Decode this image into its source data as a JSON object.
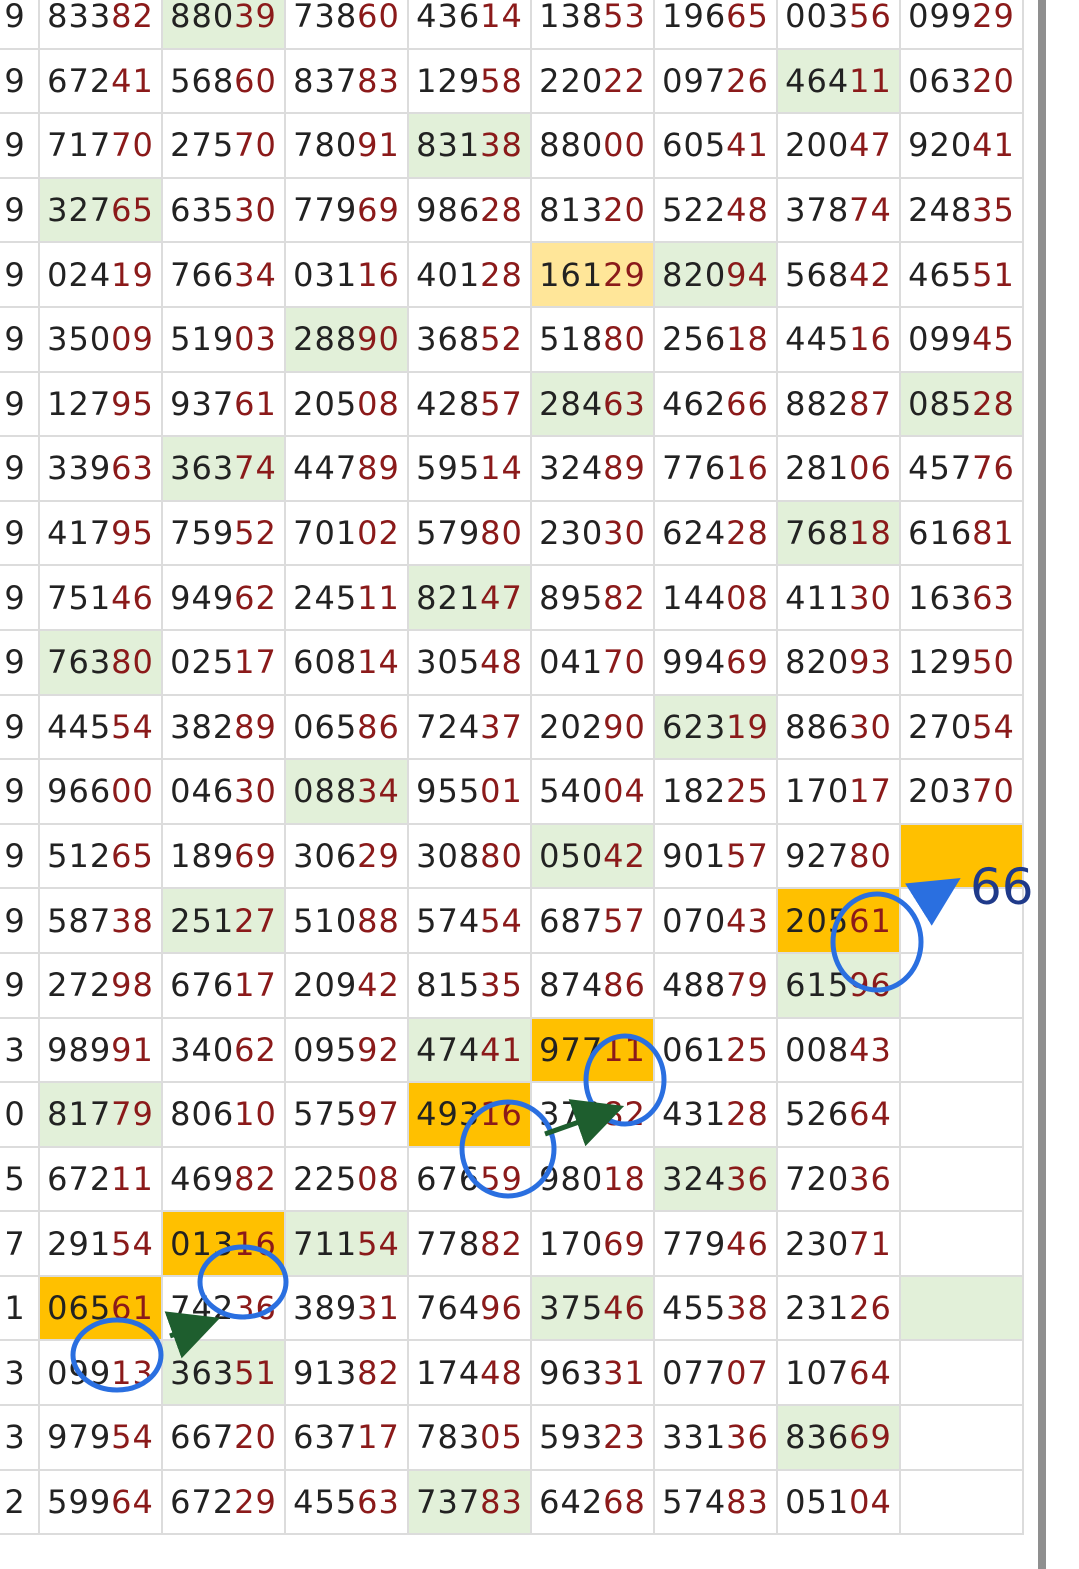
{
  "annotation_text": "66",
  "colors": {
    "cell_green": "#e2f0d9",
    "cell_yellow": "#ffc000",
    "cell_light_yellow": "#ffe699",
    "digit_dark": "#222222",
    "digit_red": "#8b1a1a",
    "circle_blue": "#2a6fe0",
    "arrow_green": "#1e5e2e"
  },
  "rows": [
    {
      "idx": "9",
      "cells": [
        {
          "v": "83382",
          "c": ""
        },
        {
          "v": "88039",
          "c": "g"
        },
        {
          "v": "73860",
          "c": ""
        },
        {
          "v": "43614",
          "c": ""
        },
        {
          "v": "13853",
          "c": ""
        },
        {
          "v": "19665",
          "c": ""
        },
        {
          "v": "00356",
          "c": ""
        },
        {
          "v": "09929",
          "c": ""
        }
      ]
    },
    {
      "idx": "9",
      "cells": [
        {
          "v": "67241",
          "c": ""
        },
        {
          "v": "56860",
          "c": ""
        },
        {
          "v": "83783",
          "c": ""
        },
        {
          "v": "12958",
          "c": ""
        },
        {
          "v": "22022",
          "c": ""
        },
        {
          "v": "09726",
          "c": ""
        },
        {
          "v": "46411",
          "c": "g"
        },
        {
          "v": "06320",
          "c": ""
        }
      ]
    },
    {
      "idx": "9",
      "cells": [
        {
          "v": "71770",
          "c": ""
        },
        {
          "v": "27570",
          "c": ""
        },
        {
          "v": "78091",
          "c": ""
        },
        {
          "v": "83138",
          "c": "g"
        },
        {
          "v": "88000",
          "c": ""
        },
        {
          "v": "60541",
          "c": ""
        },
        {
          "v": "20047",
          "c": ""
        },
        {
          "v": "92041",
          "c": ""
        }
      ]
    },
    {
      "idx": "9",
      "cells": [
        {
          "v": "32765",
          "c": "g"
        },
        {
          "v": "63530",
          "c": ""
        },
        {
          "v": "77969",
          "c": ""
        },
        {
          "v": "98628",
          "c": ""
        },
        {
          "v": "81320",
          "c": ""
        },
        {
          "v": "52248",
          "c": ""
        },
        {
          "v": "37874",
          "c": ""
        },
        {
          "v": "24835",
          "c": ""
        }
      ]
    },
    {
      "idx": "9",
      "cells": [
        {
          "v": "02419",
          "c": ""
        },
        {
          "v": "76634",
          "c": ""
        },
        {
          "v": "03116",
          "c": ""
        },
        {
          "v": "40128",
          "c": ""
        },
        {
          "v": "16129",
          "c": "ly"
        },
        {
          "v": "82094",
          "c": "g"
        },
        {
          "v": "56842",
          "c": ""
        },
        {
          "v": "46551",
          "c": ""
        }
      ]
    },
    {
      "idx": "9",
      "cells": [
        {
          "v": "35009",
          "c": ""
        },
        {
          "v": "51903",
          "c": ""
        },
        {
          "v": "28890",
          "c": "g"
        },
        {
          "v": "36852",
          "c": ""
        },
        {
          "v": "51880",
          "c": ""
        },
        {
          "v": "25618",
          "c": ""
        },
        {
          "v": "44516",
          "c": ""
        },
        {
          "v": "09945",
          "c": ""
        }
      ]
    },
    {
      "idx": "9",
      "cells": [
        {
          "v": "12795",
          "c": ""
        },
        {
          "v": "93761",
          "c": ""
        },
        {
          "v": "20508",
          "c": ""
        },
        {
          "v": "42857",
          "c": ""
        },
        {
          "v": "28463",
          "c": "g"
        },
        {
          "v": "46266",
          "c": ""
        },
        {
          "v": "88287",
          "c": ""
        },
        {
          "v": "08528",
          "c": "g"
        }
      ]
    },
    {
      "idx": "9",
      "cells": [
        {
          "v": "33963",
          "c": ""
        },
        {
          "v": "36374",
          "c": "g"
        },
        {
          "v": "44789",
          "c": ""
        },
        {
          "v": "59514",
          "c": ""
        },
        {
          "v": "32489",
          "c": ""
        },
        {
          "v": "77616",
          "c": ""
        },
        {
          "v": "28106",
          "c": ""
        },
        {
          "v": "45776",
          "c": ""
        }
      ]
    },
    {
      "idx": "9",
      "cells": [
        {
          "v": "41795",
          "c": ""
        },
        {
          "v": "75952",
          "c": ""
        },
        {
          "v": "70102",
          "c": ""
        },
        {
          "v": "57980",
          "c": ""
        },
        {
          "v": "23030",
          "c": ""
        },
        {
          "v": "62428",
          "c": ""
        },
        {
          "v": "76818",
          "c": "g"
        },
        {
          "v": "61681",
          "c": ""
        }
      ]
    },
    {
      "idx": "9",
      "cells": [
        {
          "v": "75146",
          "c": ""
        },
        {
          "v": "94962",
          "c": ""
        },
        {
          "v": "24511",
          "c": ""
        },
        {
          "v": "82147",
          "c": "g"
        },
        {
          "v": "89582",
          "c": ""
        },
        {
          "v": "14408",
          "c": ""
        },
        {
          "v": "41130",
          "c": ""
        },
        {
          "v": "16363",
          "c": ""
        }
      ]
    },
    {
      "idx": "9",
      "cells": [
        {
          "v": "76380",
          "c": "g"
        },
        {
          "v": "02517",
          "c": ""
        },
        {
          "v": "60814",
          "c": ""
        },
        {
          "v": "30548",
          "c": ""
        },
        {
          "v": "04170",
          "c": ""
        },
        {
          "v": "99469",
          "c": ""
        },
        {
          "v": "82093",
          "c": ""
        },
        {
          "v": "12950",
          "c": ""
        }
      ]
    },
    {
      "idx": "9",
      "cells": [
        {
          "v": "44554",
          "c": ""
        },
        {
          "v": "38289",
          "c": ""
        },
        {
          "v": "06586",
          "c": ""
        },
        {
          "v": "72437",
          "c": ""
        },
        {
          "v": "20290",
          "c": ""
        },
        {
          "v": "62319",
          "c": "g"
        },
        {
          "v": "88630",
          "c": ""
        },
        {
          "v": "27054",
          "c": ""
        }
      ]
    },
    {
      "idx": "9",
      "cells": [
        {
          "v": "96600",
          "c": ""
        },
        {
          "v": "04630",
          "c": ""
        },
        {
          "v": "08834",
          "c": "g"
        },
        {
          "v": "95501",
          "c": ""
        },
        {
          "v": "54004",
          "c": ""
        },
        {
          "v": "18225",
          "c": ""
        },
        {
          "v": "17017",
          "c": ""
        },
        {
          "v": "20370",
          "c": ""
        }
      ]
    },
    {
      "idx": "9",
      "cells": [
        {
          "v": "51265",
          "c": ""
        },
        {
          "v": "18969",
          "c": ""
        },
        {
          "v": "30629",
          "c": ""
        },
        {
          "v": "30880",
          "c": ""
        },
        {
          "v": "05042",
          "c": "g"
        },
        {
          "v": "90157",
          "c": ""
        },
        {
          "v": "92780",
          "c": ""
        },
        {
          "v": "",
          "c": "y"
        }
      ]
    },
    {
      "idx": "9",
      "cells": [
        {
          "v": "58738",
          "c": ""
        },
        {
          "v": "25127",
          "c": "g"
        },
        {
          "v": "51088",
          "c": ""
        },
        {
          "v": "57454",
          "c": ""
        },
        {
          "v": "68757",
          "c": ""
        },
        {
          "v": "07043",
          "c": ""
        },
        {
          "v": "20561",
          "c": "y"
        },
        {
          "v": "",
          "c": "empty"
        }
      ]
    },
    {
      "idx": "9",
      "cells": [
        {
          "v": "27298",
          "c": ""
        },
        {
          "v": "67617",
          "c": ""
        },
        {
          "v": "20942",
          "c": ""
        },
        {
          "v": "81535",
          "c": ""
        },
        {
          "v": "87486",
          "c": ""
        },
        {
          "v": "48879",
          "c": ""
        },
        {
          "v": "61596",
          "c": "g"
        },
        {
          "v": "",
          "c": "empty"
        }
      ]
    },
    {
      "idx": "3",
      "cells": [
        {
          "v": "98991",
          "c": ""
        },
        {
          "v": "34062",
          "c": ""
        },
        {
          "v": "09592",
          "c": ""
        },
        {
          "v": "47441",
          "c": "g"
        },
        {
          "v": "97711",
          "c": "y"
        },
        {
          "v": "06125",
          "c": ""
        },
        {
          "v": "00843",
          "c": ""
        },
        {
          "v": "",
          "c": "empty"
        }
      ]
    },
    {
      "idx": "0",
      "cells": [
        {
          "v": "81779",
          "c": "g"
        },
        {
          "v": "80610",
          "c": ""
        },
        {
          "v": "57597",
          "c": ""
        },
        {
          "v": "49316",
          "c": "y"
        },
        {
          "v": "37082",
          "c": ""
        },
        {
          "v": "43128",
          "c": ""
        },
        {
          "v": "52664",
          "c": ""
        },
        {
          "v": "",
          "c": "empty"
        }
      ]
    },
    {
      "idx": "5",
      "cells": [
        {
          "v": "67211",
          "c": ""
        },
        {
          "v": "46982",
          "c": ""
        },
        {
          "v": "22508",
          "c": ""
        },
        {
          "v": "67659",
          "c": ""
        },
        {
          "v": "98018",
          "c": ""
        },
        {
          "v": "32436",
          "c": "g"
        },
        {
          "v": "72036",
          "c": ""
        },
        {
          "v": "",
          "c": "empty"
        }
      ]
    },
    {
      "idx": "7",
      "cells": [
        {
          "v": "29154",
          "c": ""
        },
        {
          "v": "01316",
          "c": "y"
        },
        {
          "v": "71154",
          "c": "g"
        },
        {
          "v": "77882",
          "c": ""
        },
        {
          "v": "17069",
          "c": ""
        },
        {
          "v": "77946",
          "c": ""
        },
        {
          "v": "23071",
          "c": ""
        },
        {
          "v": "",
          "c": "empty"
        }
      ]
    },
    {
      "idx": "1",
      "cells": [
        {
          "v": "06561",
          "c": "y"
        },
        {
          "v": "74236",
          "c": ""
        },
        {
          "v": "38931",
          "c": ""
        },
        {
          "v": "76496",
          "c": ""
        },
        {
          "v": "37546",
          "c": "g"
        },
        {
          "v": "45538",
          "c": ""
        },
        {
          "v": "23126",
          "c": ""
        },
        {
          "v": "",
          "c": "g"
        }
      ]
    },
    {
      "idx": "3",
      "cells": [
        {
          "v": "09913",
          "c": ""
        },
        {
          "v": "36351",
          "c": "g"
        },
        {
          "v": "91382",
          "c": ""
        },
        {
          "v": "17448",
          "c": ""
        },
        {
          "v": "96331",
          "c": ""
        },
        {
          "v": "07707",
          "c": ""
        },
        {
          "v": "10764",
          "c": ""
        },
        {
          "v": "",
          "c": "empty"
        }
      ]
    },
    {
      "idx": "3",
      "cells": [
        {
          "v": "97954",
          "c": ""
        },
        {
          "v": "66720",
          "c": ""
        },
        {
          "v": "63717",
          "c": ""
        },
        {
          "v": "78305",
          "c": ""
        },
        {
          "v": "59323",
          "c": ""
        },
        {
          "v": "33136",
          "c": ""
        },
        {
          "v": "83669",
          "c": "g"
        },
        {
          "v": "",
          "c": "empty"
        }
      ]
    },
    {
      "idx": "2",
      "cells": [
        {
          "v": "59964",
          "c": ""
        },
        {
          "v": "67229",
          "c": ""
        },
        {
          "v": "45563",
          "c": ""
        },
        {
          "v": "73783",
          "c": "g"
        },
        {
          "v": "64268",
          "c": ""
        },
        {
          "v": "57483",
          "c": ""
        },
        {
          "v": "05104",
          "c": ""
        },
        {
          "v": "",
          "c": "empty"
        }
      ]
    }
  ]
}
